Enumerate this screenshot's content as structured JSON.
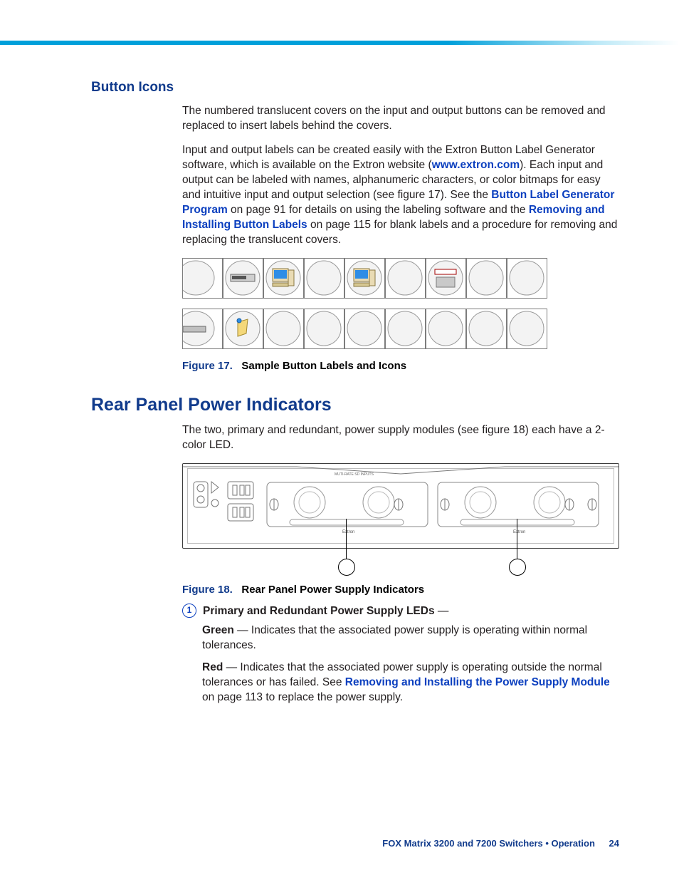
{
  "headings": {
    "button_icons": "Button Icons",
    "rear_panel": "Rear Panel Power Indicators"
  },
  "button_icons_section": {
    "p1": "The numbered translucent covers on the input and output buttons can be removed and replaced to insert labels behind the covers.",
    "p2_a": "Input and output labels can be created easily with the Extron Button Label Generator software, which is available on the Extron website (",
    "link_extron": "www.extron.com",
    "p2_b": "). Each input and output can be labeled with names, alphanumeric characters, or color bitmaps for easy and intuitive input and output selection (see figure 17). See the ",
    "link_blgp": "Button Label Generator Program",
    "p2_c": " on page 91 for details on using the labeling software and the ",
    "link_raibl": "Removing and Installing Button Labels",
    "p2_d": " on page 115 for blank labels and a procedure for removing and replacing the translucent covers.",
    "figure17_num": "Figure 17.",
    "figure17_txt": "Sample Button Labels and Icons"
  },
  "rear_panel_section": {
    "intro": "The two, primary and redundant, power supply modules (see figure 18) each have a 2-color LED.",
    "figure18_num": "Figure 18.",
    "figure18_txt": "Rear Panel Power Supply Indicators",
    "callout1_marker": "1",
    "callout1_title": "Primary and Redundant Power Supply LEDs",
    "callout1_dash": " —",
    "green_lead": "Green",
    "green_txt": " — Indicates that the associated power supply is operating within normal tolerances.",
    "red_lead": "Red",
    "red_txt_a": " — Indicates that the associated power supply is operating outside the normal tolerances or has failed. See ",
    "red_link": "Removing and Installing the Power Supply Module",
    "red_txt_b": " on page 113 to replace the power supply."
  },
  "footer": {
    "line": "FOX Matrix 3200 and 7200 Switchers • Operation",
    "page": "24"
  }
}
